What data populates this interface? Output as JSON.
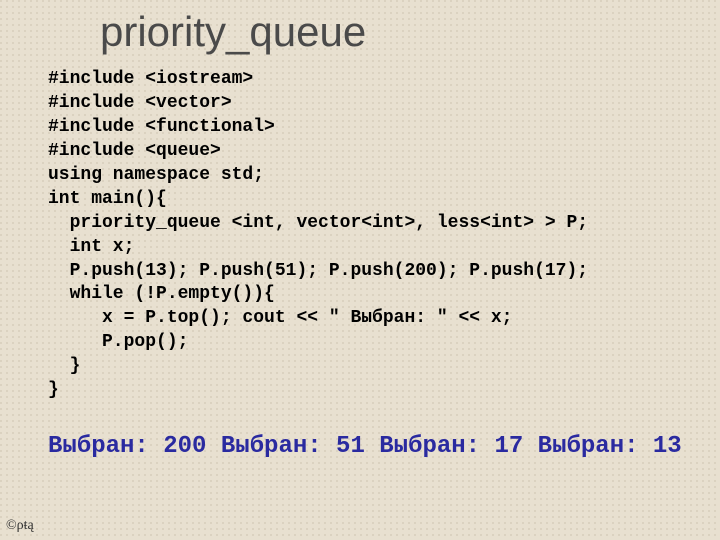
{
  "title": "priority_queue",
  "code": "#include <iostream>\n#include <vector>\n#include <functional>\n#include <queue>\nusing namespace std;\nint main(){\n  priority_queue <int, vector<int>, less<int> > P;\n  int x;\n  P.push(13); P.push(51); P.push(200); P.push(17);\n  while (!P.empty()){\n     x = P.top(); cout << \" Выбран: \" << x;\n     P.pop();\n  }\n}",
  "output": "Выбран: 200 Выбран: 51 Выбран: 17 Выбран: 13",
  "footer": "©ρŧą"
}
